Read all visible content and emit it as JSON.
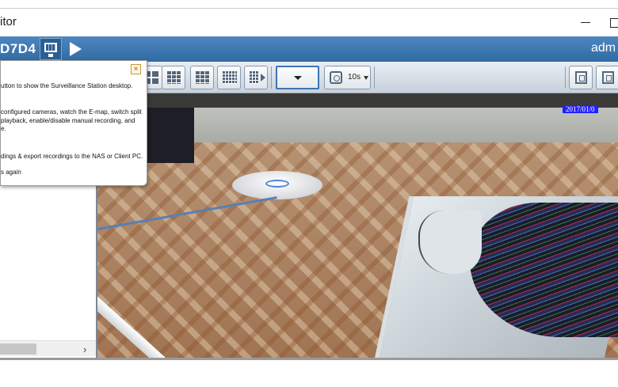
{
  "window": {
    "title": "itor"
  },
  "appbar": {
    "server_name": "D7D4",
    "user": "adm"
  },
  "toolbar": {
    "interval_label": "10s"
  },
  "video": {
    "timestamp": "2017/01/0"
  },
  "tooltip": {
    "line1": "utton to show the Surveillance Station desktop.",
    "line2": "configured cameras, watch the E-map, switch split",
    "line3": "playback, enable/disable manual recording, and",
    "line4": "e.",
    "line5": "dings & export recordings to the NAS or Client PC.",
    "line6": "s again"
  },
  "icons": {
    "close": "close-icon",
    "monitor": "monitor-icon",
    "play": "play-icon"
  },
  "colors": {
    "appbar": "#3a74ad",
    "timestamp_bg": "#2020ff",
    "accent_border": "#3d74b3"
  }
}
